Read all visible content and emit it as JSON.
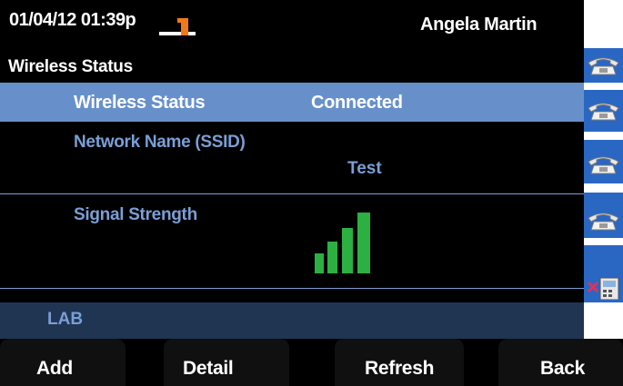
{
  "status_bar": {
    "datetime": "01/04/12 01:39p",
    "user_name": "Angela Martin",
    "handset_icon": "off-hook-handset-icon",
    "handset_color": "#f07a1a"
  },
  "header": {
    "title": "Wireless Status"
  },
  "rows": {
    "wireless_status": {
      "label": "Wireless Status",
      "value": "Connected"
    },
    "network_name": {
      "label": "Network Name (SSID)",
      "value": "Test"
    },
    "signal_strength": {
      "label": "Signal Strength",
      "level": 4,
      "max_level": 4,
      "bar_color": "#2bb041"
    }
  },
  "lab_strip": {
    "text": "LAB"
  },
  "line_keys": [
    {
      "icon": "phone-line-icon"
    },
    {
      "icon": "phone-line-icon"
    },
    {
      "icon": "phone-line-icon"
    },
    {
      "icon": "phone-line-icon"
    },
    {
      "icon": "call-forward-missed-icon"
    }
  ],
  "softkeys": {
    "add": "Add",
    "detail": "Detail",
    "refresh": "Refresh",
    "back": "Back"
  },
  "colors": {
    "selected_row": "#6790cb",
    "line_key": "#2a67c3",
    "label_text": "#7a9fd6",
    "lab_strip": "#1f3552"
  }
}
